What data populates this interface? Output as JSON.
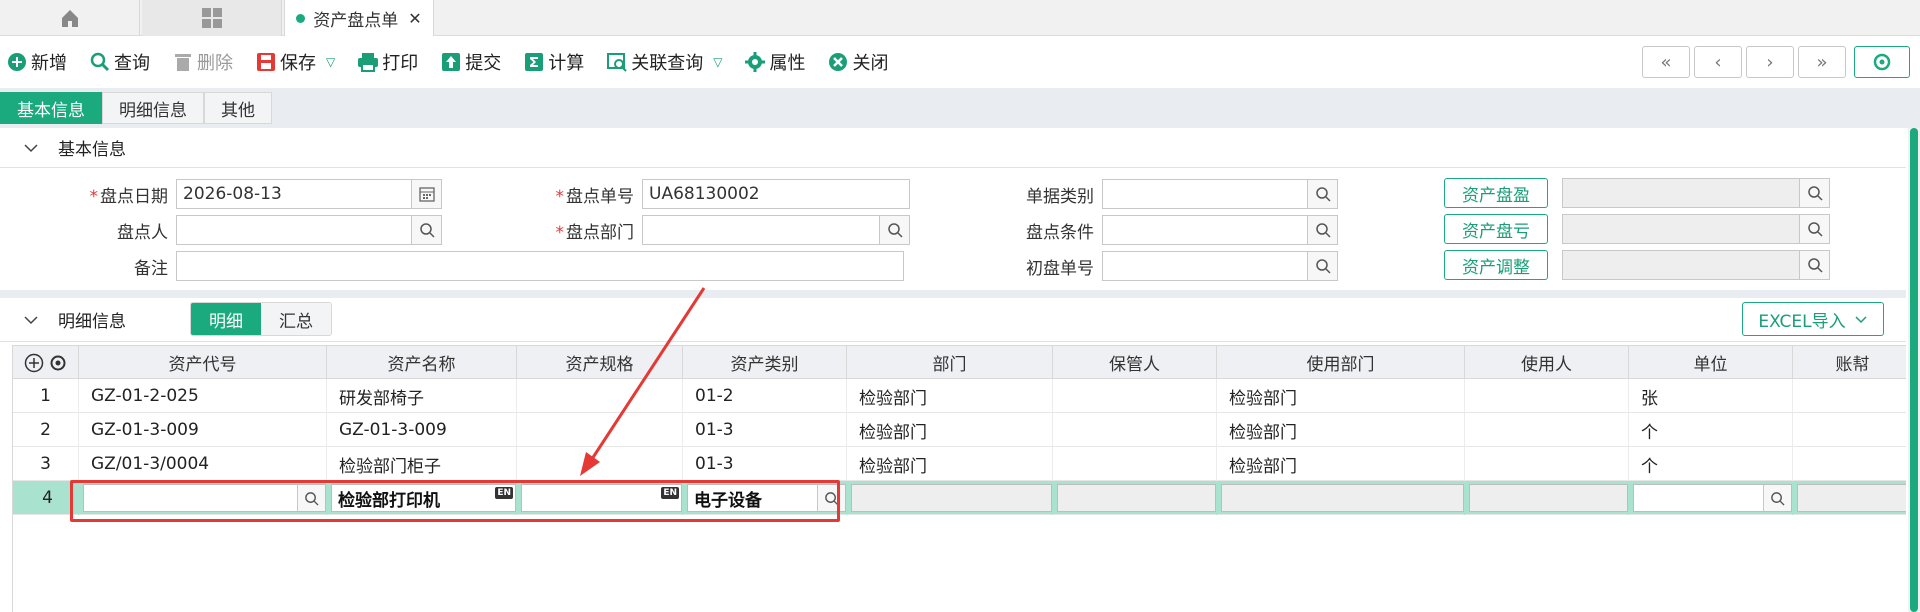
{
  "tabs": {
    "home_icon": "home-icon",
    "apps_icon": "grid-icon",
    "doc_label": "资产盘点单",
    "close": "✕"
  },
  "toolbar": {
    "new": "新增",
    "query": "查询",
    "delete": "删除",
    "save": "保存",
    "print": "打印",
    "submit": "提交",
    "calc": "计算",
    "related": "关联查询",
    "props": "属性",
    "close": "关闭"
  },
  "pager": {
    "first": "«",
    "prev": "‹",
    "next": "›",
    "last": "»"
  },
  "subtabs": [
    "基本信息",
    "明细信息",
    "其他"
  ],
  "basic": {
    "title": "基本信息",
    "date_label": "盘点日期",
    "date_value": "2026-08-13",
    "no_label": "盘点单号",
    "no_value": "UA68130002",
    "type_label": "单据类别",
    "person_label": "盘点人",
    "dept_label": "盘点部门",
    "cond_label": "盘点条件",
    "note_label": "备注",
    "first_no_label": "初盘单号",
    "btn_surplus": "资产盘盈",
    "btn_loss": "资产盘亏",
    "btn_adjust": "资产调整"
  },
  "detail": {
    "title": "明细信息",
    "tab_detail": "明细",
    "tab_summary": "汇总",
    "excel": "EXCEL导入",
    "columns": [
      "资产代号",
      "资产名称",
      "资产规格",
      "资产类别",
      "部门",
      "保管人",
      "使用部门",
      "使用人",
      "单位",
      "账幇"
    ],
    "rows": [
      {
        "no": "1",
        "code": "GZ-01-2-025",
        "name": "研发部椅子",
        "spec": "",
        "cat": "01-2",
        "dept": "检验部门",
        "keeper": "",
        "use_dept": "检验部门",
        "user": "",
        "unit": "张"
      },
      {
        "no": "2",
        "code": "GZ-01-3-009",
        "name": "GZ-01-3-009",
        "spec": "",
        "cat": "01-3",
        "dept": "检验部门",
        "keeper": "",
        "use_dept": "检验部门",
        "user": "",
        "unit": "个"
      },
      {
        "no": "3",
        "code": "GZ/01-3/0004",
        "name": "检验部门柜子",
        "spec": "",
        "cat": "01-3",
        "dept": "检验部门",
        "keeper": "",
        "use_dept": "检验部门",
        "user": "",
        "unit": "个"
      }
    ],
    "edit_row": {
      "no": "4",
      "code": "",
      "name": "检验部打印机",
      "spec": "",
      "cat": "电子设备"
    }
  },
  "colors": {
    "accent": "#1aaa7d",
    "highlight": "#e53935",
    "edit_row": "#a9e3cf"
  }
}
